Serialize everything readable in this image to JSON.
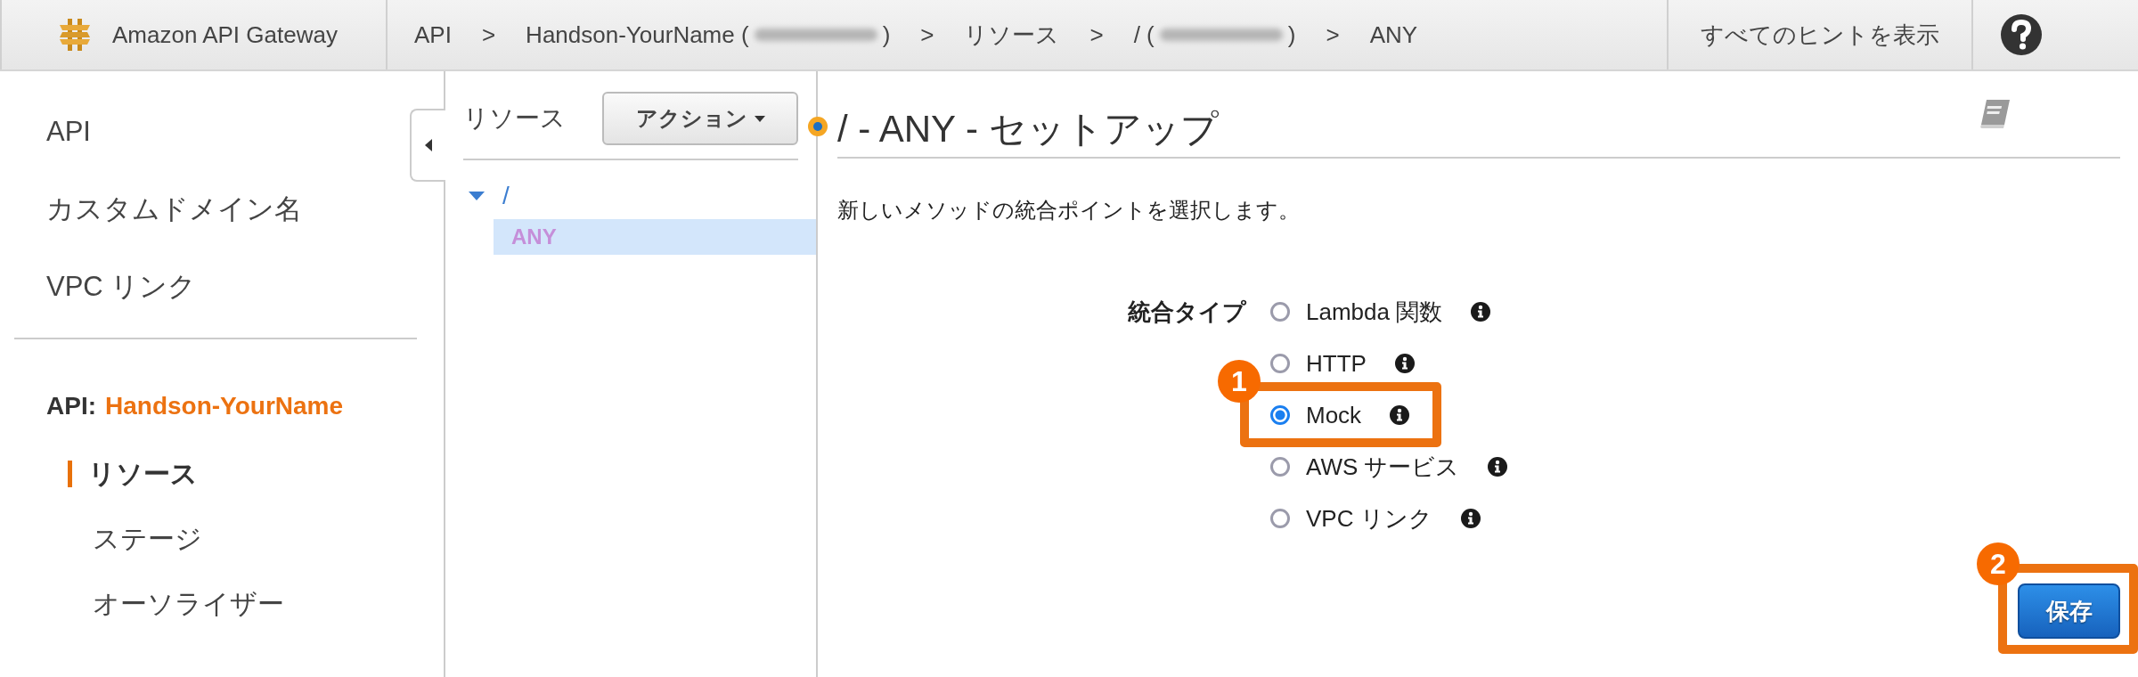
{
  "top_bar": {
    "product": "Amazon API Gateway",
    "breadcrumb": [
      {
        "kind": "crumb",
        "text": "API"
      },
      {
        "kind": "sep",
        "text": ">"
      },
      {
        "kind": "crumb",
        "text": "Handson-YourName (",
        "redacted": true,
        "after": ")"
      },
      {
        "kind": "sep",
        "text": ">"
      },
      {
        "kind": "crumb",
        "text": "リソース"
      },
      {
        "kind": "sep",
        "text": ">"
      },
      {
        "kind": "crumb",
        "text": "/ (",
        "redacted": true,
        "after": ")"
      },
      {
        "kind": "sep",
        "text": ">"
      },
      {
        "kind": "crumb",
        "text": "ANY"
      }
    ],
    "hints": "すべてのヒントを表示"
  },
  "sidebar": {
    "items": [
      {
        "label": "API"
      },
      {
        "label": "カスタムドメイン名"
      },
      {
        "label": "VPC リンク"
      }
    ],
    "api_prefix": "API:",
    "api_name": "Handson-YourName",
    "sub_items": [
      {
        "label": "リソース",
        "selected": true
      },
      {
        "label": "ステージ",
        "selected": false
      },
      {
        "label": "オーソライザー",
        "selected": false
      }
    ]
  },
  "resources": {
    "title": "リソース",
    "actions": "アクション",
    "tree": [
      {
        "label": "/",
        "expanded": true,
        "selected": false,
        "children": [
          {
            "label": "ANY",
            "selected": true
          }
        ]
      }
    ]
  },
  "main": {
    "title": "/ - ANY - セットアップ",
    "description": "新しいメソッドの統合ポイントを選択します。",
    "form_label": "統合タイプ",
    "options": [
      {
        "label": "Lambda 関数",
        "selected": false
      },
      {
        "label": "HTTP",
        "selected": false
      },
      {
        "label": "Mock",
        "selected": true,
        "callout": "1"
      },
      {
        "label": "AWS サービス",
        "selected": false
      },
      {
        "label": "VPC リンク",
        "selected": false
      }
    ],
    "save": {
      "label": "保存",
      "callout": "2"
    }
  }
}
